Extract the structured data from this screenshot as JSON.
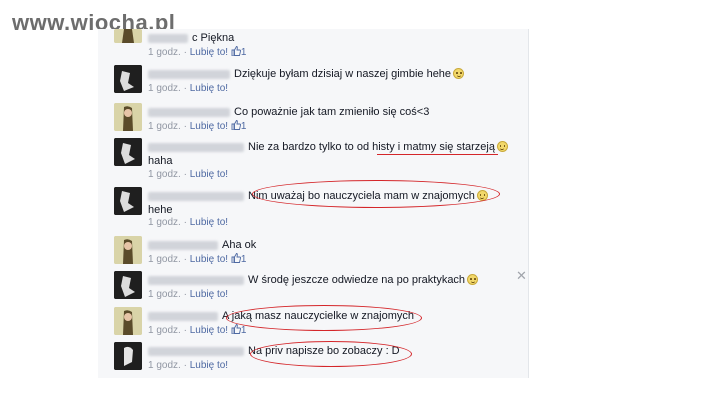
{
  "watermark": "www.wiocha.pl",
  "meta": {
    "time": "1 godz.",
    "sep": "·",
    "like": "Lubię to!"
  },
  "comments": [
    {
      "text": "c Piękna",
      "likes": "1"
    },
    {
      "text": "Dziękuje byłam dzisiaj w naszej gimbie hehe",
      "likes": ""
    },
    {
      "text": "Co poważnie jak tam zmieniło się coś<3",
      "likes": "1"
    },
    {
      "text": "Nie za bardzo tylko to od histy i matmy się starzeją",
      "text2": "haha",
      "likes": ""
    },
    {
      "text": "Nim uważaj bo nauczyciela mam w znajomych",
      "text2": "hehe",
      "likes": ""
    },
    {
      "text": "Aha ok",
      "likes": "1"
    },
    {
      "text": "W środę jeszcze odwiedze na po praktykach",
      "likes": ""
    },
    {
      "text": "A jaką masz nauczycielke w znajomych",
      "likes": "1"
    },
    {
      "text": "Na priv napisze bo zobaczy : D",
      "likes": ""
    }
  ],
  "icons": {
    "close": "close-icon",
    "like": "thumbs-up-icon",
    "emoji": "smiley-icon"
  },
  "colors": {
    "link": "#4e69a2",
    "meta": "#9197a3",
    "annotation": "#d4262a"
  }
}
